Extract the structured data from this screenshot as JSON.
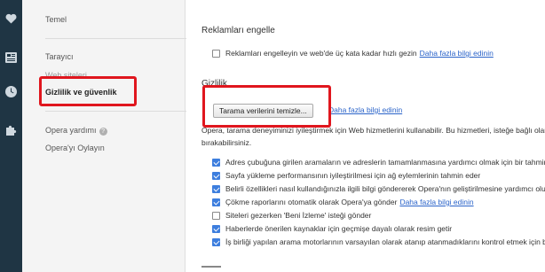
{
  "rail": {
    "icons": [
      "heart-icon",
      "news-icon",
      "clock-icon",
      "puzzle-icon"
    ]
  },
  "sidebar": {
    "items": [
      {
        "label": "Temel"
      },
      {
        "label": "Tarayıcı"
      },
      {
        "label": "Web siteleri"
      },
      {
        "label": "Gizlilik ve güvenlik"
      },
      {
        "label": "Opera yardımı"
      },
      {
        "label": "Opera'yı Oylayın"
      }
    ]
  },
  "ads": {
    "title": "Reklamları engelle",
    "checkbox_label": "Reklamları engelleyin ve web'de üç kata kadar hızlı gezin",
    "link": "Daha fazla bilgi edinin",
    "checked": false
  },
  "privacy": {
    "title": "Gizlilik",
    "clear_button": "Tarama verilerini temizle...",
    "link": "Daha fazla bilgi edinin",
    "description_line1": "Opera, tarama deneyiminizi iyileştirmek için Web hizmetlerini kullanabilir. Bu hizmetleri, isteğe bağlı olarak devre dışı",
    "description_line2": "bırakabilirsiniz.",
    "options": [
      {
        "label": "Adres çubuğuna girilen aramaların ve adreslerin tamamlanmasına yardımcı olmak için bir tahmin hizmeti kullan",
        "checked": true
      },
      {
        "label": "Sayfa yükleme performansının iyileştirilmesi için ağ eylemlerinin tahmin eder",
        "checked": true
      },
      {
        "label": "Belirli özellikleri nasıl kullandığınızla ilgili bilgi göndererek Opera'nın geliştirilmesine yardımcı olun",
        "checked": true
      },
      {
        "label": "Çökme raporlarını otomatik olarak Opera'ya gönder",
        "checked": true,
        "link": "Daha fazla bilgi edinin"
      },
      {
        "label": "Siteleri gezerken 'Beni İzleme' isteği gönder",
        "checked": false
      },
      {
        "label": "Haberlerde önerilen kaynaklar için geçmişe dayalı olarak resim getir",
        "checked": true
      },
      {
        "label": "İş birliği yapılan arama motorlarının varsayılan olarak atanıp atanmadıklarını kontrol etmek için bilgi al",
        "checked": true
      }
    ]
  },
  "colors": {
    "rail": "#1f3544",
    "highlight": "#e0161e",
    "link": "#2a63c9",
    "checkbox_on": "#3d7ede"
  }
}
